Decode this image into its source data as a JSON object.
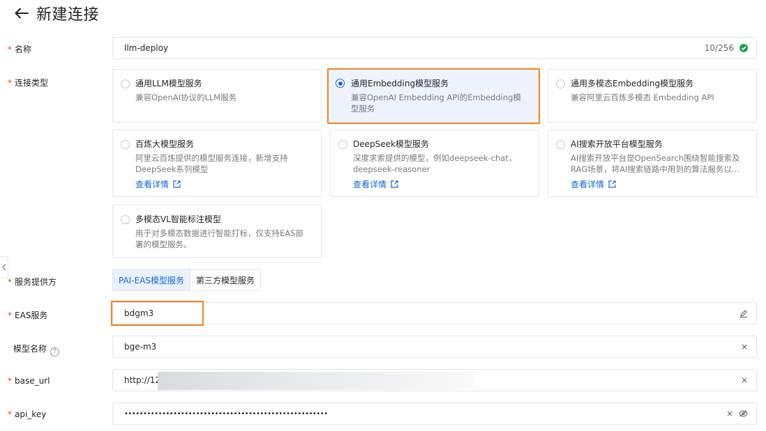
{
  "header": {
    "title": "新建连接",
    "back_icon": "arrow-left-icon"
  },
  "fields": {
    "name": {
      "label": "名称",
      "value": "llm-deploy",
      "counter": "10/256"
    },
    "connection_type": {
      "label": "连接类型"
    },
    "provider": {
      "label": "服务提供方"
    },
    "eas_service": {
      "label": "EAS服务",
      "value": "bdgm3"
    },
    "model_name": {
      "label": "模型名称",
      "value": "bge-m3"
    },
    "base_url": {
      "label": "base_url",
      "value": "http://12"
    },
    "api_key": {
      "label": "api_key",
      "value": "••••••••••••••••••••••••••••••••••••••••••••••••••••••"
    }
  },
  "connection_types": [
    {
      "title": "通用LLM模型服务",
      "desc": "兼容OpenAI协议的LLM服务",
      "selected": false
    },
    {
      "title": "通用Embedding模型服务",
      "desc": "兼容OpenAI Embedding API的Embedding模型服务",
      "selected": true
    },
    {
      "title": "通用多模态Embedding模型服务",
      "desc": "兼容阿里云百炼多模态 Embedding API",
      "selected": false
    },
    {
      "title": "百炼大模型服务",
      "desc": "阿里云百炼提供的模型服务连接，新增支持DeepSeek系列模型",
      "link": "查看详情",
      "selected": false
    },
    {
      "title": "DeepSeek模型服务",
      "desc": "深度求索提供的模型，例如deepseek-chat，deepseek-reasoner",
      "link": "查看详情",
      "selected": false
    },
    {
      "title": "AI搜索开放平台模型服务",
      "desc": "AI搜索开放平台是OpenSearch围绕智能搜索及RAG场景，将AI搜索链路中用到的算法服务以...",
      "link": "查看详情",
      "selected": false
    },
    {
      "title": "多模态VL智能标注模型",
      "desc": "用于对多模态数据进行智能打标，仅支持EAS部署的模型服务。",
      "selected": false
    }
  ],
  "provider_options": [
    {
      "label": "PAI-EAS模型服务",
      "active": true
    },
    {
      "label": "第三方模型服务",
      "active": false
    }
  ],
  "colors": {
    "accent": "#1565d8",
    "highlight": "#f5821f",
    "required": "#e8421a",
    "success": "#1aa64a"
  }
}
